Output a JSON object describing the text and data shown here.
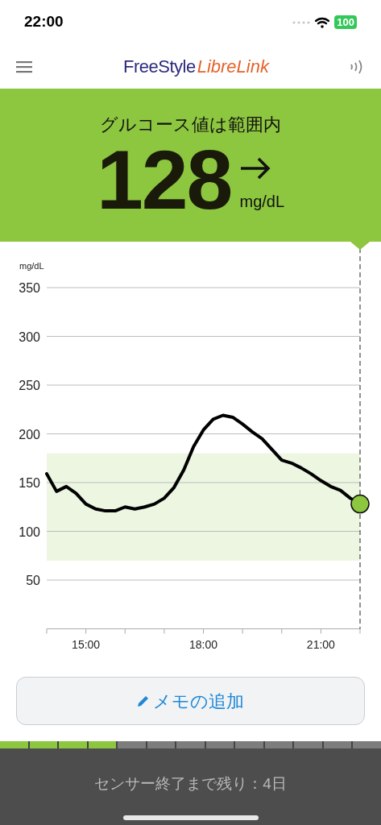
{
  "status_bar": {
    "time": "22:00",
    "battery": "100"
  },
  "header": {
    "logo": {
      "brand": "FreeStyle",
      "product": "LibreLink"
    }
  },
  "reading": {
    "status": "グルコース値は範囲内",
    "value": "128",
    "unit": "mg/dL"
  },
  "chart": {
    "chart_data": {
      "type": "line",
      "ylabel": "mg/dL",
      "xlim": [
        14,
        22
      ],
      "ylim": [
        0,
        350
      ],
      "x": [
        14,
        14.25,
        14.5,
        14.75,
        15,
        15.25,
        15.5,
        15.75,
        16,
        16.25,
        16.5,
        16.75,
        17,
        17.25,
        17.5,
        17.75,
        18,
        18.25,
        18.5,
        18.75,
        19,
        19.25,
        19.5,
        19.75,
        20,
        20.25,
        20.5,
        20.75,
        21,
        21.25,
        21.5,
        21.75,
        22
      ],
      "series": [
        {
          "color": "#000000",
          "values": [
            159,
            141,
            146,
            139,
            128,
            123,
            121,
            121,
            125,
            123,
            125,
            128,
            134,
            145,
            163,
            187,
            204,
            215,
            219,
            217,
            210,
            202,
            195,
            184,
            173,
            170,
            165,
            159,
            152,
            146,
            142,
            134,
            128
          ]
        }
      ],
      "xticks": [
        {
          "value": 15,
          "label": "15:00"
        },
        {
          "value": 18,
          "label": "18:00"
        },
        {
          "value": 21,
          "label": "21:00"
        }
      ],
      "yticks": [
        50,
        100,
        150,
        200,
        250,
        300,
        350
      ],
      "grid": true,
      "bands": [
        {
          "axis": "y",
          "from": 70,
          "to": 180,
          "color": "#ecf6e1"
        }
      ]
    }
  },
  "memo_button": {
    "label": "メモの追加"
  },
  "sensor": {
    "segments": [
      {
        "filled": true
      },
      {
        "filled": true
      },
      {
        "filled": true
      },
      {
        "filled": true
      },
      {
        "filled": false
      },
      {
        "filled": false
      },
      {
        "filled": false
      },
      {
        "filled": false
      },
      {
        "filled": false
      },
      {
        "filled": false
      },
      {
        "filled": false
      },
      {
        "filled": false
      },
      {
        "filled": false
      }
    ],
    "remaining": "センサー終了まで残り：4日"
  }
}
